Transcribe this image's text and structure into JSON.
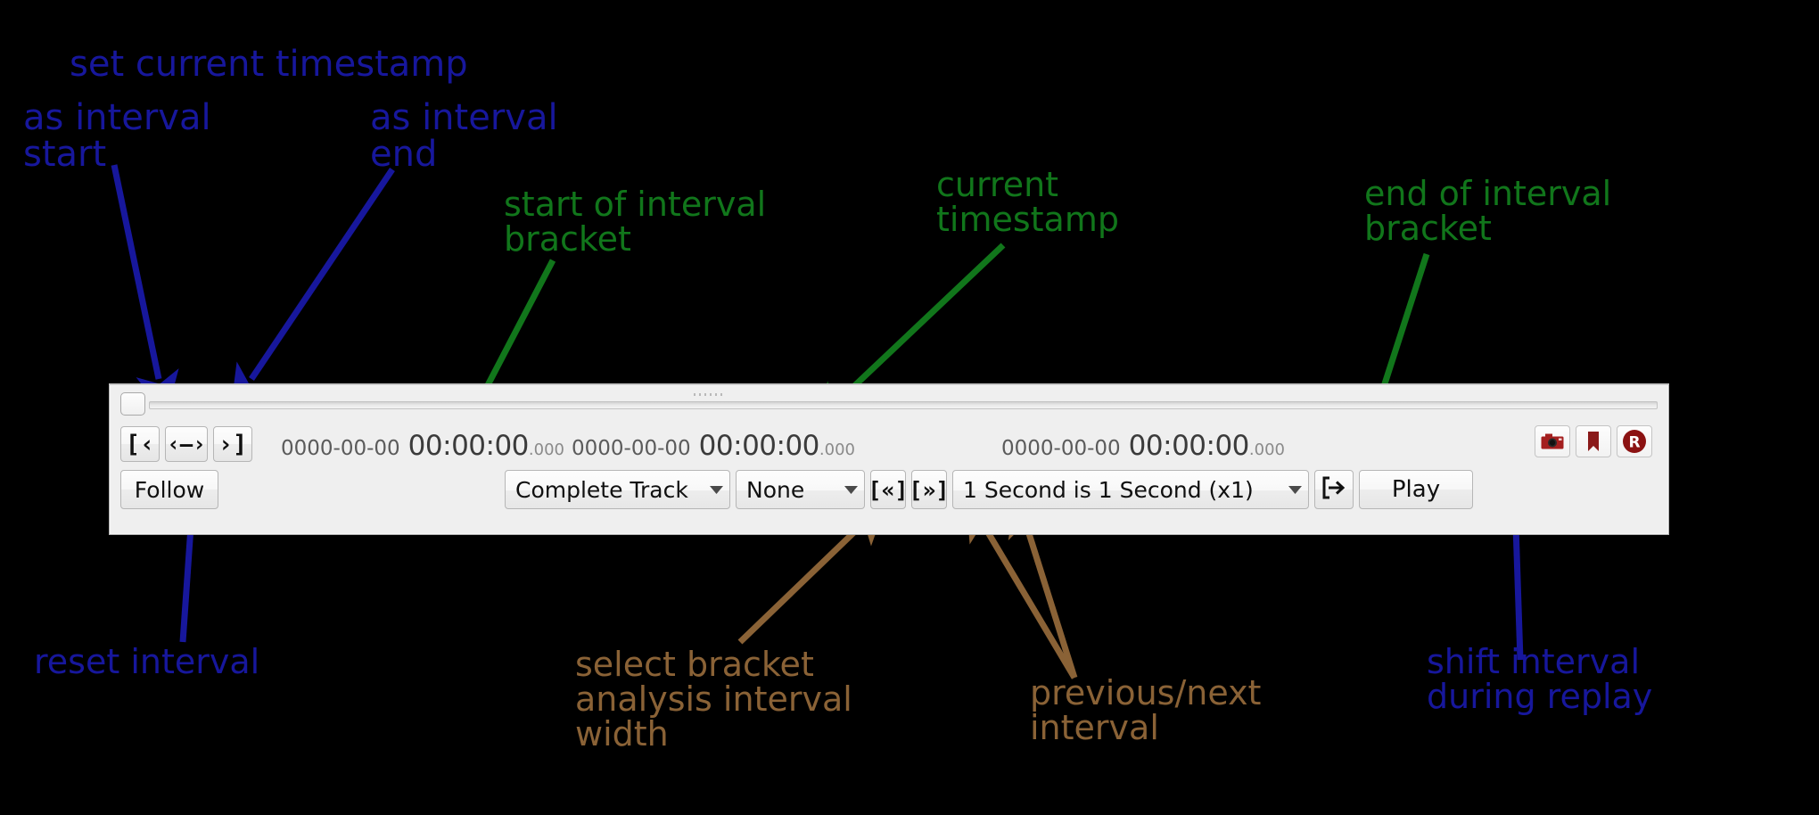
{
  "annotations": [
    {
      "id": "set-current-timestamp",
      "text": "set current timestamp",
      "color": "#17179c"
    },
    {
      "id": "as-interval-start",
      "text": "as interval\nstart",
      "color": "#17179c"
    },
    {
      "id": "as-interval-end",
      "text": "as interval\nend",
      "color": "#17179c"
    },
    {
      "id": "start-of-interval-bracket",
      "text": "start of interval\nbracket",
      "color": "#11761b"
    },
    {
      "id": "current-timestamp",
      "text": "current\ntimestamp",
      "color": "#11761b"
    },
    {
      "id": "end-of-interval-bracket",
      "text": "end of interval\nbracket",
      "color": "#11761b"
    },
    {
      "id": "reset-interval",
      "text": "reset interval",
      "color": "#17179c"
    },
    {
      "id": "select-bracket-width",
      "text": "select bracket\nanalysis interval\nwidth",
      "color": "#8a6236"
    },
    {
      "id": "previous-next-interval",
      "text": "previous/next\ninterval",
      "color": "#8a6236"
    },
    {
      "id": "shift-interval-during-replay",
      "text": "shift interval\nduring replay",
      "color": "#17179c"
    }
  ],
  "panel": {
    "interval_buttons": {
      "set_start_label": "[‹",
      "reset_label": "‹–›",
      "set_end_label": "›]"
    },
    "follow_button_label": "Follow",
    "timestamps": {
      "interval_start": {
        "date": "0000-00-00",
        "time": "00:00:00",
        "ms": ".000"
      },
      "current": {
        "date": "0000-00-00",
        "time": "00:00:00",
        "ms": ".000"
      },
      "interval_end": {
        "date": "0000-00-00",
        "time": "00:00:00",
        "ms": ".000"
      }
    },
    "track_combo": {
      "value": "Complete Track",
      "options": [
        "Complete Track"
      ]
    },
    "bracket_width_combo": {
      "value": "None",
      "options": [
        "None"
      ]
    },
    "nav_buttons": {
      "previous_label": "[«]",
      "next_label": "[»]"
    },
    "speed_combo": {
      "value": "1 Second is 1 Second (x1)",
      "options": [
        "1 Second is 1 Second (x1)"
      ]
    },
    "shift_interval_icon": "shift-interval-icon",
    "play_button_label": "Play",
    "right_icons": [
      {
        "id": "screenshot-icon",
        "name": "camera-icon",
        "color": "#a41f1f"
      },
      {
        "id": "bookmark-icon",
        "name": "bookmark-icon",
        "color": "#8b1a1a"
      },
      {
        "id": "record-icon",
        "name": "record-icon",
        "color": "#8b1212",
        "letter": "R"
      }
    ]
  }
}
